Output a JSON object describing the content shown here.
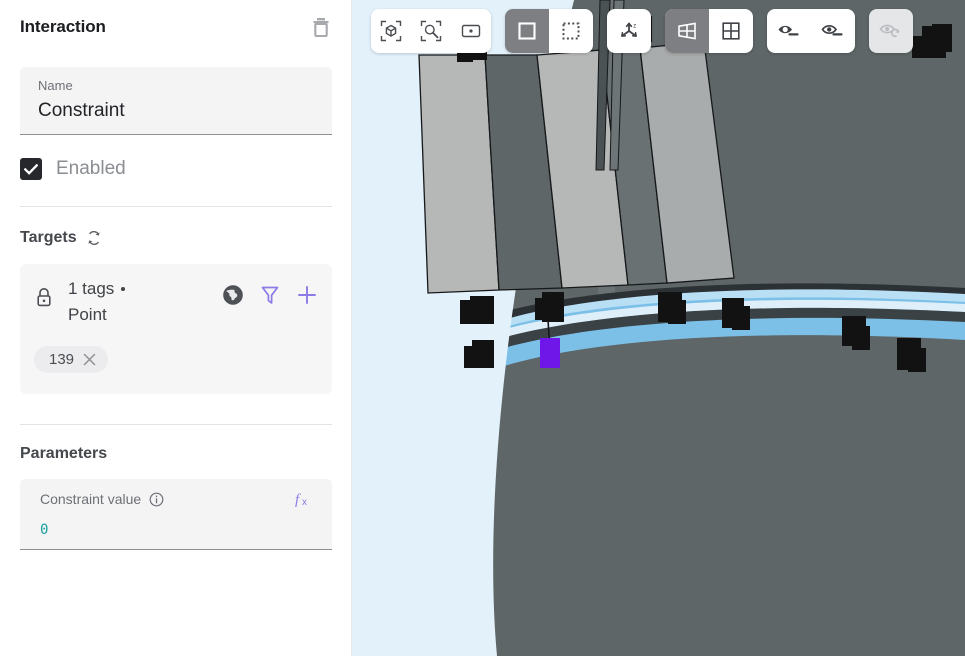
{
  "panel": {
    "title": "Interaction",
    "delete_icon": "trash-icon",
    "name_field": {
      "label": "Name",
      "value": "Constraint"
    },
    "enabled": {
      "label": "Enabled",
      "checked": true,
      "check_glyph": "✓"
    },
    "targets": {
      "title": "Targets",
      "refresh_icon": "refresh-icon",
      "card": {
        "lock_icon": "lock-icon",
        "count_label": "1 tags",
        "type_label": "Point",
        "separator_dot": "•",
        "actions": [
          {
            "name": "globe-icon",
            "label": "Globe"
          },
          {
            "name": "filter-icon",
            "label": "Filter"
          },
          {
            "name": "plus-icon",
            "label": "Add"
          }
        ],
        "chips": [
          {
            "label": "139",
            "remove_glyph": "✕"
          }
        ]
      }
    },
    "parameters": {
      "title": "Parameters",
      "items": [
        {
          "label": "Constraint value",
          "info_icon": "info-icon",
          "fx_icon": "fx-icon",
          "value": "0"
        }
      ]
    }
  },
  "viewport": {
    "background_color": "#e3f1fb",
    "toolbar": {
      "groups": [
        {
          "name": "view-tools",
          "buttons": [
            {
              "name": "fit-to-object-icon",
              "label": "Fit to object",
              "active": false,
              "disabled": false
            },
            {
              "name": "zoom-to-selection-icon",
              "label": "Zoom to selection",
              "active": false,
              "disabled": false
            },
            {
              "name": "center-view-icon",
              "label": "Center view",
              "active": false,
              "disabled": false
            }
          ]
        },
        {
          "name": "selection-mode",
          "buttons": [
            {
              "name": "box-select-solid-icon",
              "label": "Box select",
              "active": true,
              "disabled": false
            },
            {
              "name": "lasso-select-dashed-icon",
              "label": "Marquee select",
              "active": false,
              "disabled": false
            }
          ]
        },
        {
          "name": "axis-gizmo",
          "buttons": [
            {
              "name": "axes-triad-icon",
              "label": "Show axes",
              "active": false,
              "disabled": false
            }
          ]
        },
        {
          "name": "display-mode",
          "buttons": [
            {
              "name": "perspective-grid-icon",
              "label": "Perspective grid",
              "active": true,
              "disabled": false
            },
            {
              "name": "flat-grid-icon",
              "label": "Flat grid",
              "active": false,
              "disabled": false
            }
          ]
        },
        {
          "name": "visibility",
          "buttons": [
            {
              "name": "eye-hide-icon",
              "label": "Hide",
              "active": false,
              "disabled": false
            },
            {
              "name": "eye-show-icon",
              "label": "Show",
              "active": false,
              "disabled": false
            }
          ]
        },
        {
          "name": "visibility-reset",
          "buttons": [
            {
              "name": "eye-reset-icon",
              "label": "Reset visibility",
              "active": false,
              "disabled": true
            }
          ]
        }
      ]
    },
    "scene": {
      "name": "3d-mesh-model",
      "colors": {
        "background": "#e3f1fb",
        "body_dark": "#4e5757",
        "body_mid": "#5e6667",
        "panel_light": "#b6b8b8",
        "panel_mid": "#9fa2a2",
        "band_blue": "#7cc0e8",
        "band_blue_light": "#9fd3ef",
        "node_black": "#121212",
        "selected_node": "#6f16e8"
      },
      "selected_node_label": "selected-point-marker"
    }
  },
  "scrollbar": {
    "name": "panel-scrollbar",
    "visible": true
  }
}
